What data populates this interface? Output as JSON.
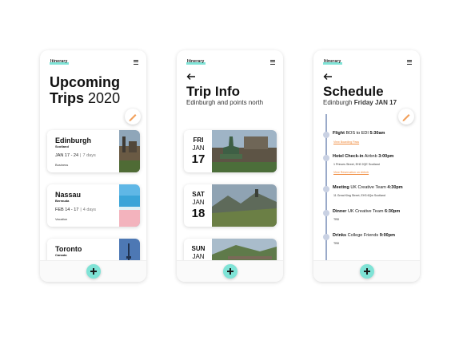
{
  "app": {
    "logo": "Itinerary"
  },
  "trips_screen": {
    "title_line1": "Upcoming",
    "title_word": "Trips",
    "title_year": "2020",
    "trips": [
      {
        "city": "Edinburgh",
        "country": "Scotland",
        "dates": "JAN 17 - 24",
        "days": "7 days",
        "tag": "Business"
      },
      {
        "city": "Nassau",
        "country": "Bermuda",
        "dates": "FEB 14 - 17",
        "days": "4 days",
        "tag": "Vacation"
      },
      {
        "city": "Toronto",
        "country": "Canada"
      }
    ]
  },
  "trip_info_screen": {
    "title": "Trip Info",
    "subtitle": "Edinburgh and points north",
    "days": [
      {
        "dow": "FRI",
        "month": "JAN",
        "day": "17"
      },
      {
        "dow": "SAT",
        "month": "JAN",
        "day": "18"
      },
      {
        "dow": "SUN",
        "month": "JAN"
      }
    ]
  },
  "schedule_screen": {
    "title": "Schedule",
    "subtitle_city": "Edinburgh",
    "subtitle_date": "Friday JAN 17",
    "events": [
      {
        "title": "Flight",
        "desc": "BOS to EDI",
        "time": "5:30am",
        "link": "View Boarding Pass"
      },
      {
        "title": "Hotel Check-in",
        "desc": "Airbnb",
        "time": "3:00pm",
        "detail": "1 Princes Street, EH2 2QE Scotland",
        "link": "View Reservation on Airbnb"
      },
      {
        "title": "Meeting",
        "desc": "UK Creative Team",
        "time": "4:30pm",
        "detail": "11 Great King Street, EH3 6Qw Scotland"
      },
      {
        "title": "Dinner",
        "desc": "UK Creative Team",
        "time": "6:30pm",
        "detail": "TBD"
      },
      {
        "title": "Drinks",
        "desc": "College Friends",
        "time": "9:00pm",
        "detail": "TBD"
      }
    ]
  },
  "colors": {
    "accent": "#7fe3d6",
    "link": "#f08a3b",
    "timeline": "#9aaac9"
  },
  "icons": {
    "menu": "hamburger-icon",
    "back": "back-arrow-icon",
    "edit": "pencil-icon",
    "add": "plus-icon"
  }
}
